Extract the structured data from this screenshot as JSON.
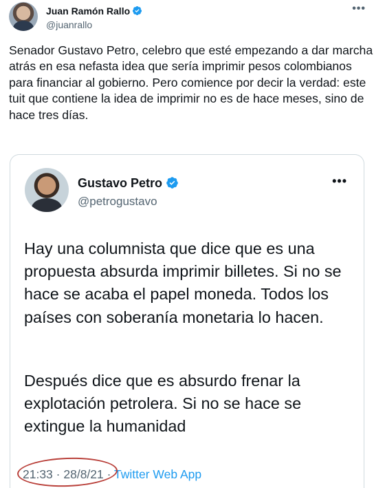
{
  "outer_tweet": {
    "author_name": "Juan Ramón Rallo",
    "author_handle": "@juanrallo",
    "more_icon": "•••",
    "text": "Senador Gustavo Petro, celebro que esté empezando a dar marcha atrás en esa nefasta idea que sería imprimir pesos colombianos para financiar al gobierno. Pero comience por decir la verdad: este tuit que contiene la idea de imprimir no es de hace meses, sino de hace tres días."
  },
  "quoted_tweet": {
    "author_name": "Gustavo Petro",
    "author_handle": "@petrogustavo",
    "more_icon": "•••",
    "paragraph_1": "Hay una columnista que dice que es una propuesta absurda imprimir billetes. Si no se hace se acaba el papel moneda. Todos los países con soberanía monetaria lo hacen.",
    "paragraph_2": "Después dice que es absurdo frenar la explotación petrolera. Si no se hace se extingue la humanidad",
    "time": "21:33",
    "sep": "·",
    "date": "28/8/21",
    "app": "Twitter Web App"
  },
  "colors": {
    "verified_blue": "#1d9bf0",
    "link_blue": "#1d9bf0",
    "annotation_red": "#b9403a"
  }
}
